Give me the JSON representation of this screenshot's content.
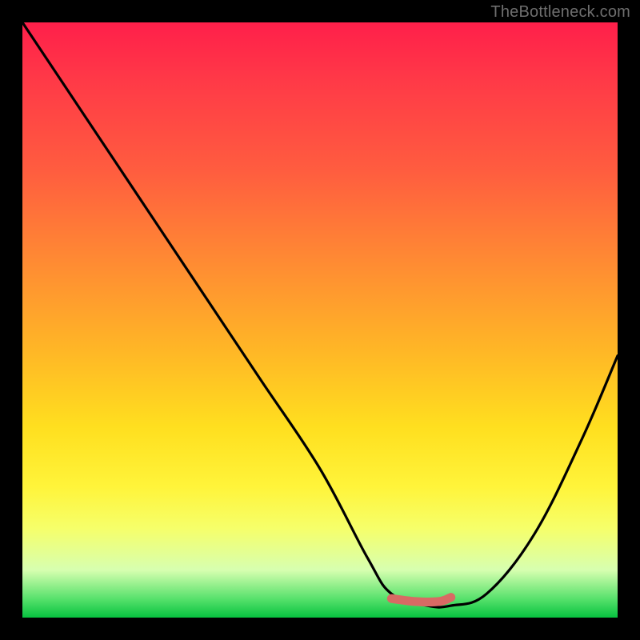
{
  "watermark": "TheBottleneck.com",
  "chart_data": {
    "type": "line",
    "title": "",
    "xlabel": "",
    "ylabel": "",
    "xlim": [
      0,
      100
    ],
    "ylim": [
      0,
      100
    ],
    "series": [
      {
        "name": "bottleneck-curve",
        "x": [
          0,
          10,
          20,
          30,
          40,
          50,
          58,
          62,
          68,
          72,
          78,
          86,
          94,
          100
        ],
        "values": [
          100,
          85,
          70,
          55,
          40,
          25,
          10,
          4,
          2,
          2,
          4,
          14,
          30,
          44
        ]
      },
      {
        "name": "optimal-band",
        "x": [
          62,
          66,
          70,
          72
        ],
        "values": [
          3.2,
          2.7,
          2.7,
          3.4
        ]
      }
    ],
    "annotations": []
  },
  "colors": {
    "curve": "#000000",
    "optimal_band": "#d86a64",
    "background_top": "#ff1f4a",
    "background_bottom": "#07c23f",
    "frame": "#000000"
  }
}
